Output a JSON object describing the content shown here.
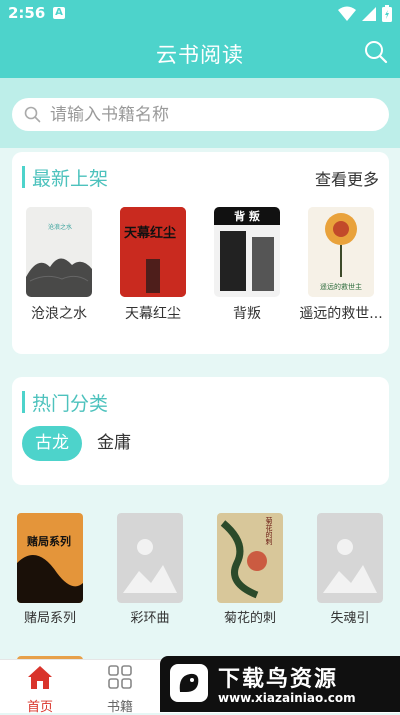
{
  "status": {
    "time": "2:56",
    "notif_letter": "A"
  },
  "app": {
    "title": "云书阅读"
  },
  "search": {
    "placeholder": "请输入书籍名称"
  },
  "latest": {
    "title": "最新上架",
    "more": "查看更多",
    "books": [
      {
        "title": "沧浪之水",
        "cover_text": "沧浪之水"
      },
      {
        "title": "天幕红尘",
        "cover_text": "天幕红尘"
      },
      {
        "title": "背叛",
        "cover_text": "背 叛"
      },
      {
        "title": "遥远的救世...",
        "cover_text": "遥远的救世主"
      }
    ]
  },
  "categories": {
    "title": "热门分类",
    "items": [
      {
        "label": "古龙",
        "active": true
      },
      {
        "label": "金庸",
        "active": false
      }
    ]
  },
  "grid": {
    "books": [
      {
        "title": "赌局系列",
        "cover_text": "赌局系列"
      },
      {
        "title": "彩环曲"
      },
      {
        "title": "菊花的刺",
        "cover_text": "菊花的刺"
      },
      {
        "title": "失魂引"
      }
    ]
  },
  "tabs": [
    {
      "label": "首页",
      "active": true
    },
    {
      "label": "书籍",
      "active": false
    }
  ],
  "watermark": {
    "title": "下载鸟资源",
    "url": "www.xiazainiao.com"
  },
  "colors": {
    "accent": "#4dd3cb",
    "band": "#bdeee9",
    "bg": "#e6f7f5",
    "tab_active": "#d9342b"
  }
}
